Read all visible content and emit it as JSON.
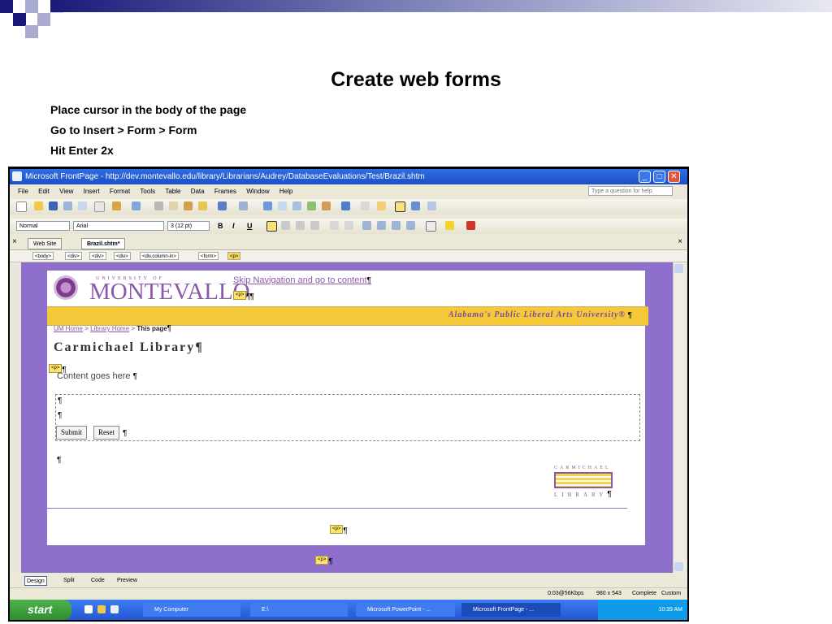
{
  "slide": {
    "title": "Create web forms",
    "bullets": [
      "Place cursor in the body of the page",
      "Go to Insert > Form > Form",
      "Hit Enter 2x"
    ]
  },
  "window": {
    "title": "Microsoft FrontPage - http://dev.montevallo.edu/library/Librarians/Audrey/DatabaseEvaluations/Test/Brazil.shtm",
    "minimize": "_",
    "maximize": "□",
    "close": "✕"
  },
  "menu": {
    "items": [
      "File",
      "Edit",
      "View",
      "Insert",
      "Format",
      "Tools",
      "Table",
      "Data",
      "Frames",
      "Window",
      "Help"
    ],
    "help_placeholder": "Type a question for help"
  },
  "format_toolbar": {
    "style": "Normal",
    "font": "Arial",
    "size": "3 (12 pt)",
    "bold": "B",
    "italic": "I",
    "underline": "U"
  },
  "tabs": [
    {
      "label": "Web Site"
    },
    {
      "label": "Brazil.shtm*"
    }
  ],
  "tag_selector": [
    "<body>",
    "<div>",
    "<div>",
    "<div>",
    "<div.column-in>",
    "<form>",
    "<p>"
  ],
  "page": {
    "logo_small": "UNIVERSITY OF",
    "logo_big": "MONTEVALLO",
    "pilcrow": "¶",
    "skip_nav": "Skip Navigation and go to content",
    "p_tag": "<p>",
    "banner": "Alabama's Public Liberal Arts University®",
    "breadcrumb": {
      "home": "UM Home",
      "sep": ">",
      "library": "Library Home",
      "current": "This page"
    },
    "library_title": "Carmichael Library",
    "content": "Content goes here",
    "submit": "Submit",
    "reset": "Reset",
    "lib_logo_top": "CARMICHAEL",
    "lib_logo_bottom": "LIBRARY"
  },
  "viewbar": {
    "design": "Design",
    "split": "Split",
    "code": "Code",
    "preview": "Preview"
  },
  "status": {
    "speed": "0:03@56Kbps",
    "dims": "980 x 543",
    "state": "Complete",
    "mode": "Custom"
  },
  "taskbar": {
    "start": "start",
    "tasks": [
      "My Computer",
      "E:\\",
      "Microsoft PowerPoint - ...",
      "Microsoft FrontPage - ..."
    ],
    "time": "10:39 AM"
  }
}
